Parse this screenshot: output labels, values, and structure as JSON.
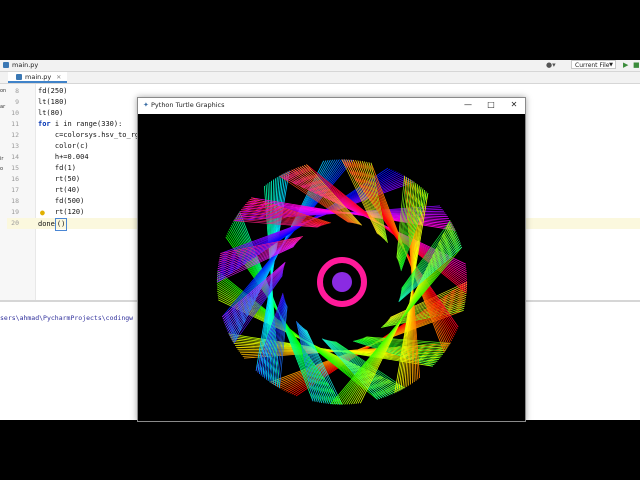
{
  "ide": {
    "path_file": "main.py",
    "run_config": "Current File",
    "tab_label": "main.py",
    "left_strip_marks": [
      "on",
      "ar",
      "ir",
      "o"
    ]
  },
  "editor": {
    "lines": [
      {
        "num": "8",
        "code": "fd(250)"
      },
      {
        "num": "9",
        "code": "lt(180)"
      },
      {
        "num": "10",
        "code": "lt(80)"
      },
      {
        "num": "11",
        "kw": "for",
        "code": " i in range(330):"
      },
      {
        "num": "12",
        "code": "    c=colorsys.hsv_to_rg"
      },
      {
        "num": "13",
        "code": "    color(c)"
      },
      {
        "num": "14",
        "code": "    h+=0.004"
      },
      {
        "num": "15",
        "code": "    fd(1)"
      },
      {
        "num": "16",
        "code": "    rt(50)"
      },
      {
        "num": "17",
        "code": "    rt(40)"
      },
      {
        "num": "18",
        "code": "    fd(500)"
      },
      {
        "num": "19",
        "code": "    rt(120)"
      },
      {
        "num": "20",
        "code": "done",
        "cursor_char": "()"
      }
    ]
  },
  "run_panel": {
    "output_line": "sers\\ahmad\\PycharmProjects\\codingw"
  },
  "turtle_window": {
    "title": "Python Turtle Graphics",
    "minimize_glyph": "—",
    "maximize_glyph": "□",
    "close_glyph": "✕",
    "canvas_color": "#000000",
    "drawing": {
      "petals": 12,
      "strands_per_petal": 14,
      "palette": "hsv rainbow"
    }
  }
}
